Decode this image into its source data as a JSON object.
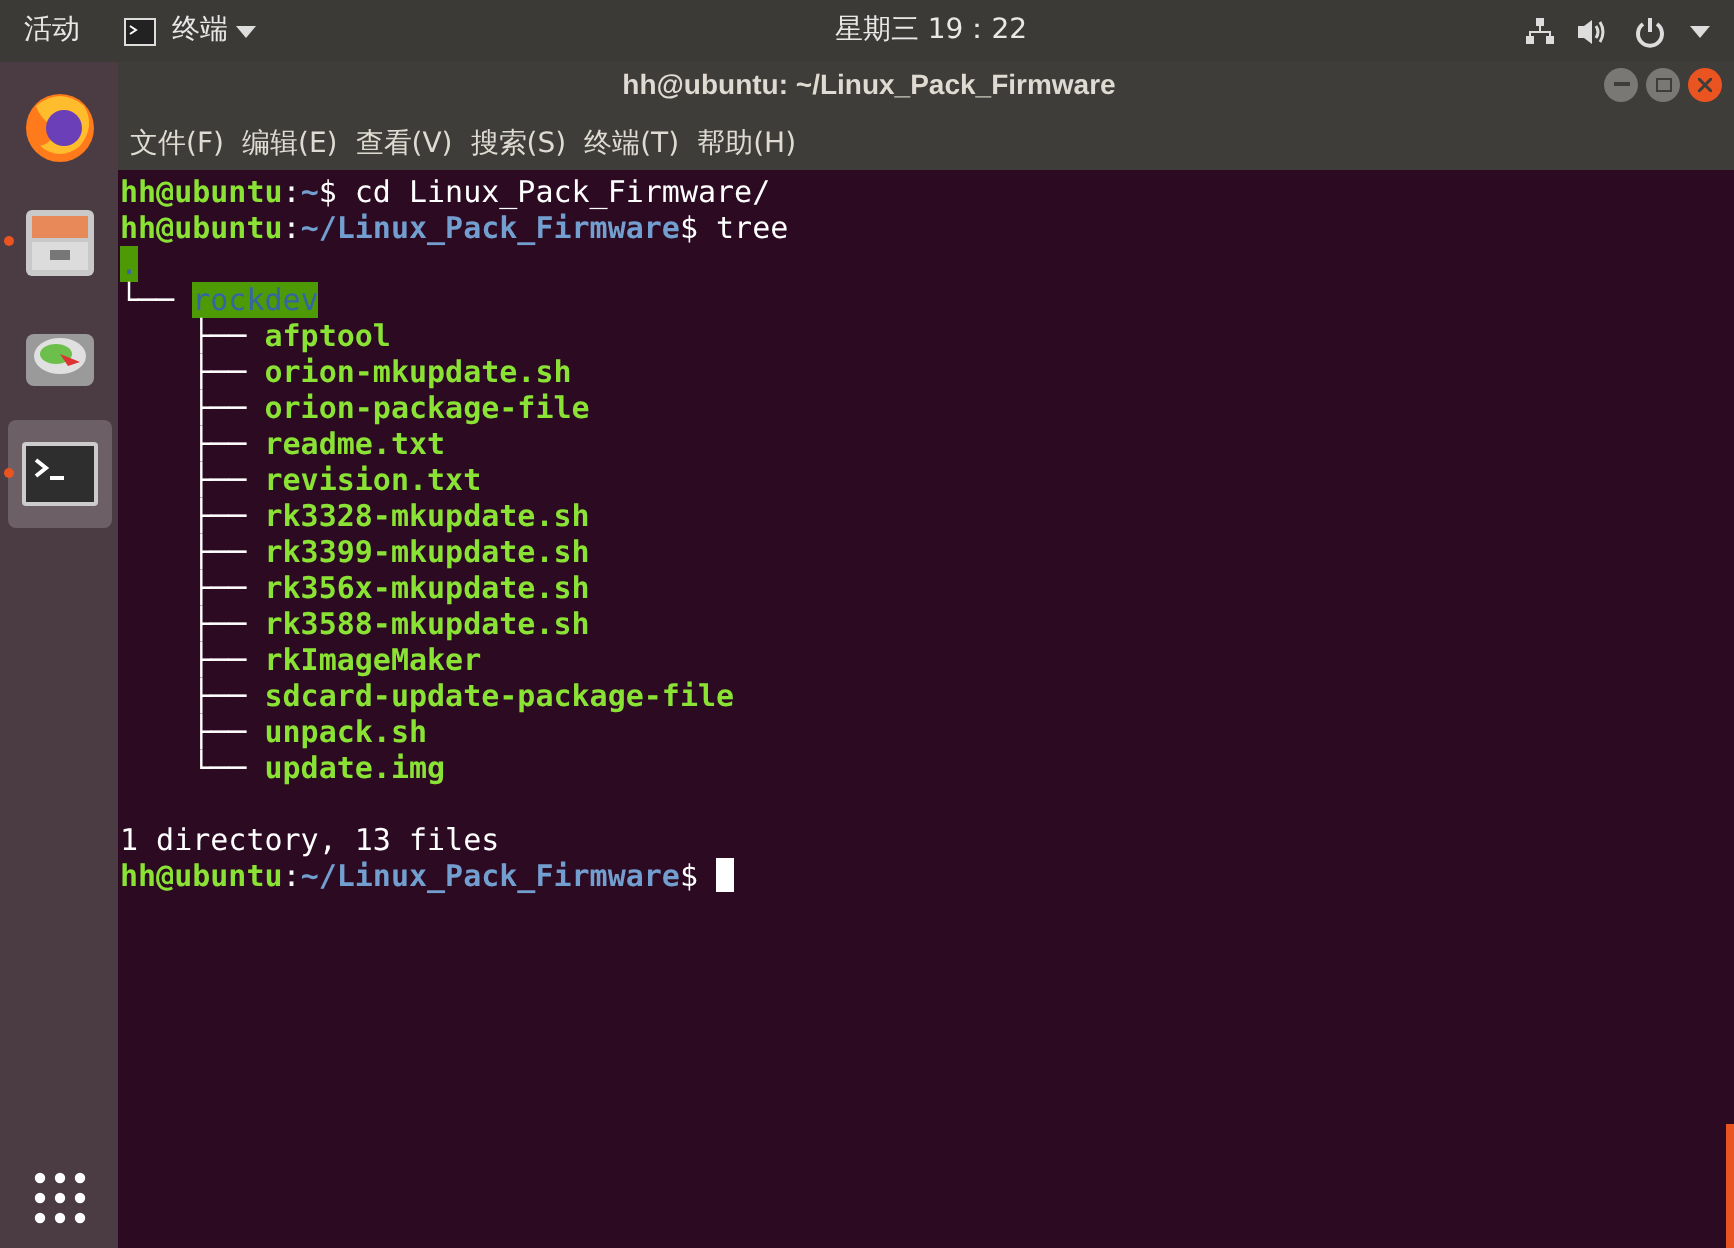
{
  "top_bar": {
    "activities": "活动",
    "app_menu": "终端",
    "clock": "星期三 19：22"
  },
  "dock": {
    "items": [
      {
        "kind": "browser",
        "running": false,
        "selected": false
      },
      {
        "kind": "files",
        "running": true,
        "selected": false
      },
      {
        "kind": "disk",
        "running": false,
        "selected": false
      },
      {
        "kind": "terminal",
        "running": true,
        "selected": true
      }
    ]
  },
  "window": {
    "title": "hh@ubuntu: ~/Linux_Pack_Firmware"
  },
  "menu": [
    "文件(F)",
    "编辑(E)",
    "查看(V)",
    "搜索(S)",
    "终端(T)",
    "帮助(H)"
  ],
  "terminal": {
    "lines": [
      {
        "kind": "prompt",
        "user": "hh@ubuntu",
        "sep": ":",
        "path": "~",
        "sign": "$",
        "command": " cd Linux_Pack_Firmware/"
      },
      {
        "kind": "prompt",
        "user": "hh@ubuntu",
        "sep": ":",
        "path": "~/Linux_Pack_Firmware",
        "sign": "$",
        "command": " tree"
      },
      {
        "kind": "dir",
        "name": "."
      },
      {
        "kind": "dir",
        "prefix": "└── ",
        "name": "rockdev"
      },
      {
        "kind": "file",
        "prefix": "    ├── ",
        "name": "afptool"
      },
      {
        "kind": "file",
        "prefix": "    ├── ",
        "name": "orion-mkupdate.sh"
      },
      {
        "kind": "file",
        "prefix": "    ├── ",
        "name": "orion-package-file"
      },
      {
        "kind": "file",
        "prefix": "    ├── ",
        "name": "readme.txt"
      },
      {
        "kind": "file",
        "prefix": "    ├── ",
        "name": "revision.txt"
      },
      {
        "kind": "file",
        "prefix": "    ├── ",
        "name": "rk3328-mkupdate.sh"
      },
      {
        "kind": "file",
        "prefix": "    ├── ",
        "name": "rk3399-mkupdate.sh"
      },
      {
        "kind": "file",
        "prefix": "    ├── ",
        "name": "rk356x-mkupdate.sh"
      },
      {
        "kind": "file",
        "prefix": "    ├── ",
        "name": "rk3588-mkupdate.sh"
      },
      {
        "kind": "file",
        "prefix": "    ├── ",
        "name": "rkImageMaker"
      },
      {
        "kind": "file",
        "prefix": "    ├── ",
        "name": "sdcard-update-package-file"
      },
      {
        "kind": "file",
        "prefix": "    ├── ",
        "name": "unpack.sh"
      },
      {
        "kind": "file",
        "prefix": "    └── ",
        "name": "update.img"
      },
      {
        "kind": "blank"
      },
      {
        "kind": "text",
        "text": "1 directory, 13 files"
      },
      {
        "kind": "prompt",
        "user": "hh@ubuntu",
        "sep": ":",
        "path": "~/Linux_Pack_Firmware",
        "sign": "$",
        "cursor": true
      }
    ]
  }
}
